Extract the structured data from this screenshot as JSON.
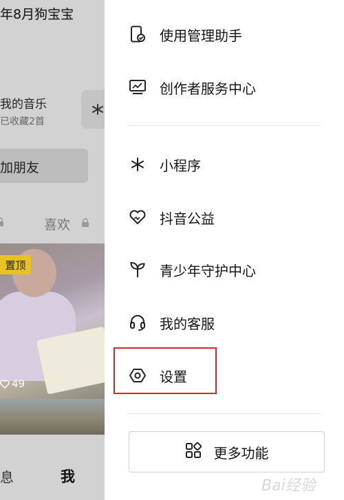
{
  "background_page": {
    "title": "年8月狗宝宝",
    "music_title": "我的音乐",
    "music_subtitle": "已收藏2首",
    "add_friend": "加朋友",
    "tab_likes": "喜欢",
    "pin_badge": "置顶",
    "like_count": "49",
    "nav_messages": "息",
    "nav_me": "我"
  },
  "menu": {
    "items": [
      {
        "label": "使用管理助手",
        "icon": "phone-check-icon"
      },
      {
        "label": "创作者服务中心",
        "icon": "monitor-chart-icon"
      },
      {
        "label": "小程序",
        "icon": "mini-program-icon"
      },
      {
        "label": "抖音公益",
        "icon": "heart-charity-icon"
      },
      {
        "label": "青少年守护中心",
        "icon": "sprout-icon"
      },
      {
        "label": "我的客服",
        "icon": "headset-icon"
      },
      {
        "label": "设置",
        "icon": "settings-hexagon-icon"
      }
    ],
    "more_button": "更多功能",
    "highlight_color": "#d9262c"
  },
  "watermark": "Bai经验"
}
